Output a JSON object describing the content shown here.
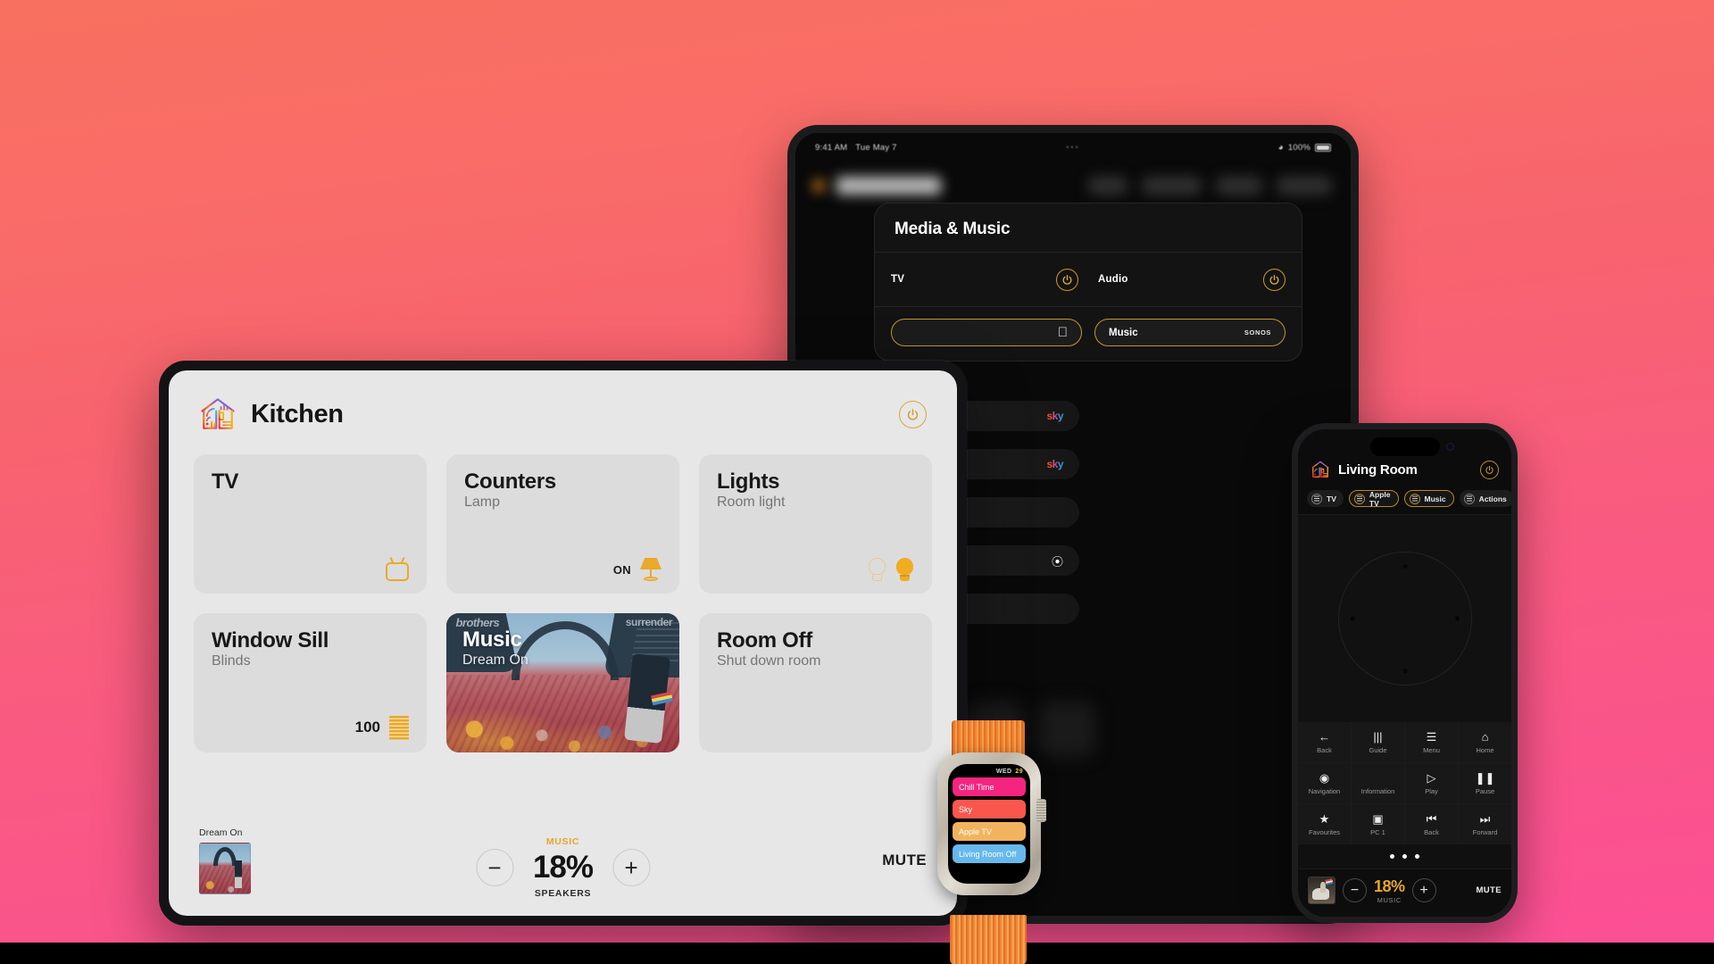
{
  "background": {
    "top_color": "#F8705F",
    "bottom_color": "#FC4F96"
  },
  "ipad_back": {
    "status_bar": {
      "time": "9:41 AM",
      "date": "Tue May 7",
      "battery_pct": "100%",
      "wifi_icon": "wifi-icon",
      "battery_icon": "battery-icon"
    },
    "card": {
      "title": "Media & Music",
      "rows": [
        {
          "label": "TV",
          "power_icon": "power-icon"
        },
        {
          "label": "Audio",
          "power_icon": "power-icon"
        }
      ],
      "pills": [
        {
          "label": "",
          "badge": "",
          "icon": "apple-logo-icon"
        },
        {
          "label": "Music",
          "badge": "SONOS",
          "icon": ""
        }
      ]
    },
    "list_items": [
      {
        "badge": "sky",
        "type": "sky-logo"
      },
      {
        "badge": "sky",
        "type": "sky-logo"
      },
      {
        "badge": "",
        "type": "blank"
      },
      {
        "badge": "",
        "type": "pacman-icon"
      },
      {
        "badge": "",
        "type": "blank"
      }
    ]
  },
  "ipad_front": {
    "logo_icon": "home-house-logo-icon",
    "title": "Kitchen",
    "power_icon": "power-icon",
    "tiles": [
      {
        "title": "TV",
        "subtitle": "",
        "state": "",
        "value": "",
        "icon": "tv-icon"
      },
      {
        "title": "Counters",
        "subtitle": "Lamp",
        "state": "ON",
        "value": "",
        "icon": "lamp-icon"
      },
      {
        "title": "Lights",
        "subtitle": "Room light",
        "state": "",
        "value": "",
        "icon": "lightbulb-icon"
      },
      {
        "title": "Window Sill",
        "subtitle": "Blinds",
        "state": "",
        "value": "100",
        "icon": "blinds-icon"
      },
      {
        "title": "Music",
        "subtitle": "Dream On",
        "state": "",
        "value": "",
        "icon": "album-art",
        "media": true,
        "art_text_left": "brothers",
        "art_text_right": "surrender"
      },
      {
        "title": "Room Off",
        "subtitle": "Shut down room",
        "state": "",
        "value": "",
        "icon": ""
      }
    ],
    "bottom_bar": {
      "now_playing_label": "Dream On",
      "now_playing_art": "album-art-thumbnail",
      "source_label": "MUSIC",
      "volume_pct": "18%",
      "zone_label": "SPEAKERS",
      "minus_label": "−",
      "plus_label": "+",
      "mute_label": "MUTE"
    }
  },
  "iphone": {
    "logo_icon": "home-house-logo-icon",
    "title": "Living Room",
    "power_icon": "power-icon",
    "tabs": [
      {
        "label": "TV",
        "active": false
      },
      {
        "label": "Apple TV",
        "active": true
      },
      {
        "label": "Music",
        "active": true
      },
      {
        "label": "Actions",
        "active": false
      }
    ],
    "dpad": {
      "name": "directional-touchpad",
      "dots": 4
    },
    "buttons": [
      {
        "label": "Back",
        "glyph": "←",
        "icon": "arrow-left-icon"
      },
      {
        "label": "Guide",
        "glyph": "|||",
        "icon": "guide-icon"
      },
      {
        "label": "Menu",
        "glyph": "☰",
        "icon": "menu-icon"
      },
      {
        "label": "Home",
        "glyph": "⌂",
        "icon": "home-icon"
      },
      {
        "label": "Navigation",
        "glyph": "◉",
        "icon": "navigation-icon"
      },
      {
        "label": "Information",
        "glyph": "",
        "icon": "information-icon"
      },
      {
        "label": "Play",
        "glyph": "▷",
        "icon": "play-icon"
      },
      {
        "label": "Pause",
        "glyph": "❚❚",
        "icon": "pause-icon"
      },
      {
        "label": "Favourites",
        "glyph": "★",
        "icon": "star-icon"
      },
      {
        "label": "PC 1",
        "glyph": "▣",
        "icon": "display-icon"
      },
      {
        "label": "Back",
        "glyph": "⏮",
        "icon": "skip-back-icon"
      },
      {
        "label": "Forward",
        "glyph": "⏭",
        "icon": "skip-forward-icon"
      }
    ],
    "page_dots": 3,
    "bottom_bar": {
      "now_playing_art": "album-art-thumbnail",
      "minus_label": "−",
      "volume_pct": "18%",
      "source_label": "MUSIC",
      "plus_label": "+",
      "mute_label": "MUTE"
    }
  },
  "watch": {
    "date_day": "WED",
    "date_num": "29",
    "items": [
      {
        "label": "Chill Time",
        "color": "#F5257F"
      },
      {
        "label": "Sky",
        "color": "#F9574E"
      },
      {
        "label": "Apple TV",
        "color": "#F2B35E"
      },
      {
        "label": "Living Room Off",
        "color": "#67B8EC"
      }
    ]
  }
}
